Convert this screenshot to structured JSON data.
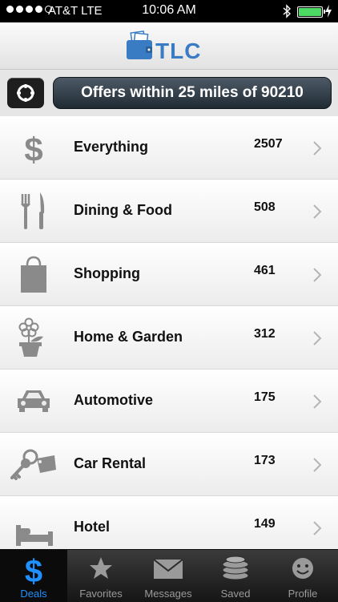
{
  "status": {
    "carrier": "AT&T  LTE",
    "time": "10:06 AM"
  },
  "header": {
    "app_name": "TLC"
  },
  "offers": {
    "label": "Offers within 25 miles of 90210"
  },
  "categories": [
    {
      "label": "Everything",
      "count": "2507",
      "icon": "dollar-icon"
    },
    {
      "label": "Dining & Food",
      "count": "508",
      "icon": "fork-knife-icon"
    },
    {
      "label": "Shopping",
      "count": "461",
      "icon": "shopping-bag-icon"
    },
    {
      "label": "Home & Garden",
      "count": "312",
      "icon": "flower-pot-icon"
    },
    {
      "label": "Automotive",
      "count": "175",
      "icon": "car-icon"
    },
    {
      "label": "Car Rental",
      "count": "173",
      "icon": "car-keys-icon"
    },
    {
      "label": "Hotel",
      "count": "149",
      "icon": "bed-icon"
    }
  ],
  "tabs": [
    {
      "label": "Deals",
      "icon": "dollar-tab-icon",
      "active": true
    },
    {
      "label": "Favorites",
      "icon": "star-icon"
    },
    {
      "label": "Messages",
      "icon": "envelope-icon"
    },
    {
      "label": "Saved",
      "icon": "coins-icon"
    },
    {
      "label": "Profile",
      "icon": "smiley-icon"
    }
  ],
  "colors": {
    "accent": "#1e90ff",
    "logo": "#3a7cc3",
    "battery": "#4cd964"
  }
}
